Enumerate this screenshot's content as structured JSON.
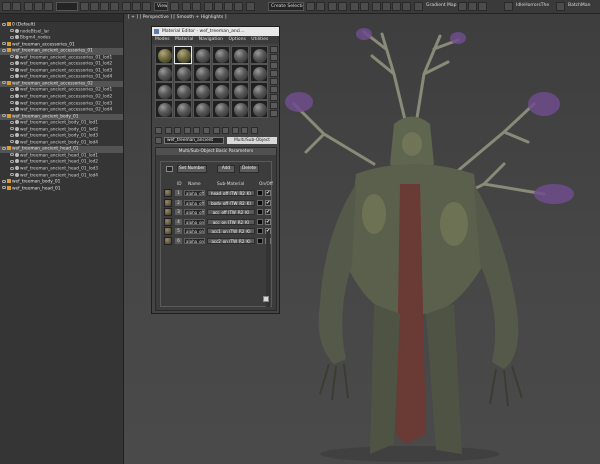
{
  "toolbar": {
    "selection_set_placeholder": "Create Selection Se",
    "view_dropdown": "View",
    "gradient_label": "Gradient Map",
    "script_label": "IdleHorrorsThe",
    "batch_label": "BatchMan"
  },
  "viewport": {
    "label": "[ + ] [ Perspective ] [ Smooth + Highlights ]"
  },
  "scene_explorer": {
    "items": [
      {
        "name": "0 (Default)",
        "type": "group"
      },
      {
        "name": "nodeBtsel_lar",
        "type": "item"
      },
      {
        "name": "Bbgm4_nodes",
        "type": "item"
      },
      {
        "name": "wef_treeman_accessories_01",
        "type": "group"
      },
      {
        "name": "wef_treeman_ancient_accessories_01",
        "type": "group",
        "selected": true
      },
      {
        "name": "wef_treeman_ancient_accessories_01_lod1",
        "type": "item"
      },
      {
        "name": "wef_treeman_ancient_accessories_01_lod2",
        "type": "item"
      },
      {
        "name": "wef_treeman_ancient_accessories_01_lod3",
        "type": "item"
      },
      {
        "name": "wef_treeman_ancient_accessories_01_lod4",
        "type": "item"
      },
      {
        "name": "wef_treeman_ancient_accessories_02",
        "type": "group",
        "selected": true
      },
      {
        "name": "wef_treeman_ancient_accessories_02_lod1",
        "type": "item"
      },
      {
        "name": "wef_treeman_ancient_accessories_02_lod2",
        "type": "item"
      },
      {
        "name": "wef_treeman_ancient_accessories_02_lod3",
        "type": "item"
      },
      {
        "name": "wef_treeman_ancient_accessories_02_lod4",
        "type": "item"
      },
      {
        "name": "wef_treeman_ancient_body_01",
        "type": "group",
        "selected": true
      },
      {
        "name": "wef_treeman_ancient_body_01_lod1",
        "type": "item"
      },
      {
        "name": "wef_treeman_ancient_body_01_lod2",
        "type": "item"
      },
      {
        "name": "wef_treeman_ancient_body_01_lod3",
        "type": "item"
      },
      {
        "name": "wef_treeman_ancient_body_01_lod4",
        "type": "item"
      },
      {
        "name": "wef_treeman_ancient_head_01",
        "type": "group",
        "selected": true
      },
      {
        "name": "wef_treeman_ancient_head_01_lod1",
        "type": "item"
      },
      {
        "name": "wef_treeman_ancient_head_01_lod2",
        "type": "item"
      },
      {
        "name": "wef_treeman_ancient_head_01_lod3",
        "type": "item"
      },
      {
        "name": "wef_treeman_ancient_head_01_lod4",
        "type": "item"
      },
      {
        "name": "wef_treeman_body_01",
        "type": "group"
      },
      {
        "name": "wef_treeman_head_01",
        "type": "group"
      }
    ]
  },
  "material_editor": {
    "title": "Material Editor - wef_treeman_anci...",
    "menu": [
      "Modes",
      "Material",
      "Navigation",
      "Options",
      "Utilities"
    ],
    "material_name": "wef_treeman_ancient",
    "material_type": "Multi/Sub-Object",
    "rollout_title": "Multi/Sub-Object Basic Parameters",
    "set_number_label": "Set Number",
    "add_label": "Add",
    "delete_label": "Delete",
    "col_id": "ID",
    "col_name": "Name",
    "col_sub": "Sub-Material",
    "col_onoff": "On/Off",
    "rows": [
      {
        "id": "1",
        "name": "alpha_off",
        "sub": "head_off (TW_R2_K)",
        "on": "✔"
      },
      {
        "id": "2",
        "name": "alpha_off",
        "sub": "body_off (TW_R2_K)",
        "on": "✔"
      },
      {
        "id": "3",
        "name": "alpha_off",
        "sub": "acc_off (TW_R2_K)",
        "on": "✔"
      },
      {
        "id": "4",
        "name": "alpha_on",
        "sub": "acc_on (TW_R2_K)",
        "on": "✔"
      },
      {
        "id": "5",
        "name": "alpha_on",
        "sub": "acc1_on (TW_R2_K)",
        "on": "✔"
      },
      {
        "id": "6",
        "name": "alpha_on",
        "sub": "acc2_on (TW_R2_K)",
        "on": "✔"
      }
    ]
  }
}
